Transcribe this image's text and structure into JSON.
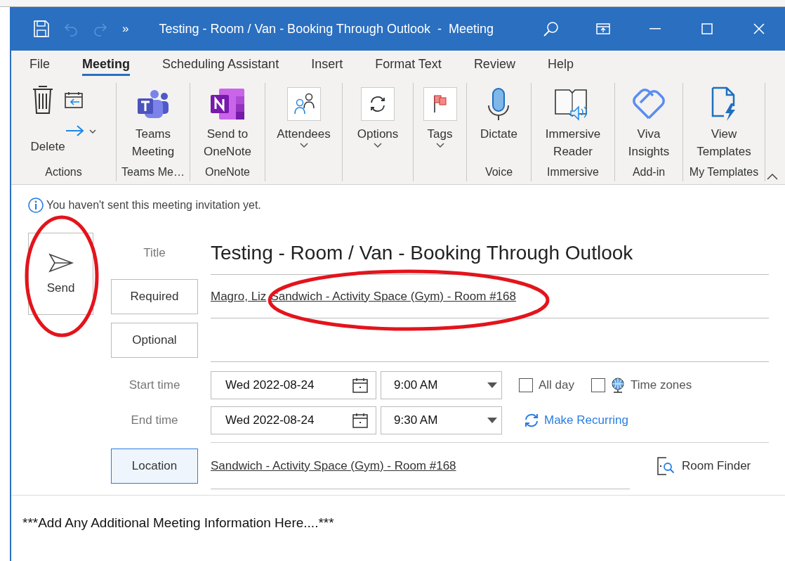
{
  "window": {
    "title": "Testing - Room / Van - Booking Through Outlook  -  Meeting",
    "overflow": "»"
  },
  "tabs": [
    {
      "label": "File",
      "selected": false
    },
    {
      "label": "Meeting",
      "selected": true
    },
    {
      "label": "Scheduling Assistant",
      "selected": false
    },
    {
      "label": "Insert",
      "selected": false
    },
    {
      "label": "Format Text",
      "selected": false
    },
    {
      "label": "Review",
      "selected": false
    },
    {
      "label": "Help",
      "selected": false
    }
  ],
  "ribbon": {
    "groups": [
      {
        "label": "Actions",
        "buttons": [
          {
            "kind": "delete",
            "label": "Delete",
            "dropdown": false
          }
        ]
      },
      {
        "label": "Teams Me…",
        "buttons": [
          {
            "kind": "teams",
            "label": "Teams\nMeeting",
            "dropdown": false
          }
        ]
      },
      {
        "label": "OneNote",
        "buttons": [
          {
            "kind": "onenote",
            "label": "Send to\nOneNote",
            "dropdown": false
          }
        ]
      },
      {
        "buttons": [
          {
            "kind": "attendees",
            "label": "Attendees",
            "dropdown": true
          }
        ]
      },
      {
        "buttons": [
          {
            "kind": "options",
            "label": "Options",
            "dropdown": true
          }
        ]
      },
      {
        "buttons": [
          {
            "kind": "tags",
            "label": "Tags",
            "dropdown": true
          }
        ]
      },
      {
        "label": "Voice",
        "buttons": [
          {
            "kind": "dictate",
            "label": "Dictate",
            "dropdown": false
          }
        ]
      },
      {
        "label": "Immersive",
        "buttons": [
          {
            "kind": "reader",
            "label": "Immersive\nReader",
            "dropdown": false
          }
        ]
      },
      {
        "label": "Add-in",
        "buttons": [
          {
            "kind": "viva",
            "label": "Viva\nInsights",
            "dropdown": false
          }
        ]
      },
      {
        "label": "My Templates",
        "buttons": [
          {
            "kind": "templates",
            "label": "View\nTemplates",
            "dropdown": false
          }
        ]
      }
    ]
  },
  "info": "You haven't sent this meeting invitation yet.",
  "send": {
    "label": "Send"
  },
  "form": {
    "title": {
      "label": "Title",
      "value": "Testing - Room / Van - Booking Through Outlook"
    },
    "required": {
      "label": "Required",
      "selected": false,
      "attendees": [
        "Magro, Liz",
        "Sandwich - Activity Space (Gym) - Room #168"
      ]
    },
    "optional": {
      "label": "Optional",
      "selected": false
    },
    "start": {
      "label": "Start time",
      "date": "Wed 2022-08-24",
      "time": "9:00 AM"
    },
    "end": {
      "label": "End time",
      "date": "Wed 2022-08-24",
      "time": "9:30 AM"
    },
    "all_day": {
      "label": "All day",
      "checked": false
    },
    "time_zones": {
      "label": "Time zones",
      "checked": false
    },
    "recurring": {
      "label": "Make Recurring"
    },
    "location": {
      "label": "Location",
      "selected": true,
      "value": "Sandwich - Activity Space (Gym) - Room #168"
    },
    "room_finder": {
      "label": "Room Finder"
    }
  },
  "body": "***Add Any Additional Meeting Information Here....***"
}
